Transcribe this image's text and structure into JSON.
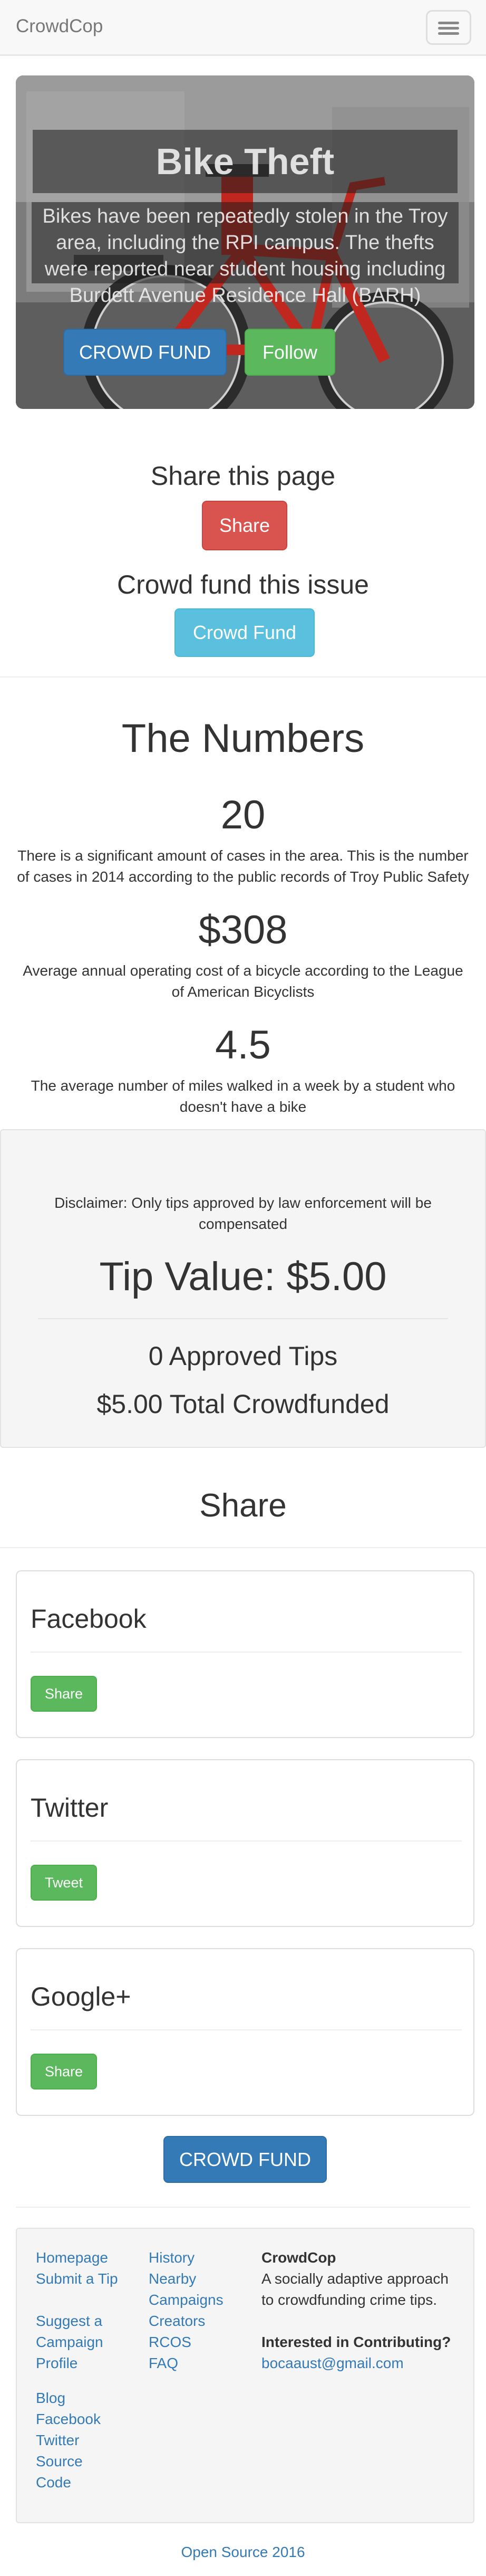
{
  "navbar": {
    "brand": "CrowdCop",
    "toggle_icon": "hamburger-menu-icon"
  },
  "hero": {
    "title": "Bike Theft",
    "description": "Bikes have been repeatedly stolen in the Troy area, including the RPI campus. The thefts were reported near student housing including Burdett Avenue Residence Hall (BARH)",
    "fund_label": "CROWD FUND",
    "follow_label": "Follow",
    "background_image": "red-bicycle-photo"
  },
  "share_section": {
    "heading": "Share this page",
    "share_label": "Share",
    "fund_heading": "Crowd fund this issue",
    "fund_label": "Crowd Fund"
  },
  "numbers": {
    "heading": "The Numbers",
    "stats": [
      {
        "value": "20",
        "description": "There is a significant amount of cases in the area. This is the number of cases in 2014 according to the public records of Troy Public Safety"
      },
      {
        "value": "$308",
        "description": "Average annual operating cost of a bicycle according to the League of American Bicyclists"
      },
      {
        "value": "4.5",
        "description": "The average number of miles walked in a week by a student who doesn't have a bike"
      }
    ]
  },
  "tips": {
    "disclaimer": "Disclaimer: Only tips approved by law enforcement will be compensated",
    "tip_value": "Tip Value: $5.00",
    "approved": "0 Approved Tips",
    "total": "$5.00 Total Crowdfunded"
  },
  "social": {
    "heading": "Share",
    "panels": [
      {
        "title": "Facebook",
        "button": "Share"
      },
      {
        "title": "Twitter",
        "button": "Tweet"
      },
      {
        "title": "Google+",
        "button": "Share"
      }
    ],
    "fund_label": "CROWD FUND"
  },
  "footer": {
    "col1": [
      "Homepage",
      "Submit a Tip",
      "Suggest a Campaign",
      "Profile"
    ],
    "col1b": [
      "Blog",
      "Facebook",
      "Twitter",
      "Source Code"
    ],
    "col2": [
      "History",
      "Nearby Campaigns",
      "Creators",
      "RCOS",
      "FAQ"
    ],
    "about_title": "CrowdCop",
    "about_text": "A socially adaptive approach to crowdfunding crime tips.",
    "contrib_title": "Interested in Contributing?",
    "contrib_email": "bocaaust@gmail.com",
    "bottom_link": "Open Source 2016"
  },
  "colors": {
    "primary": "#337ab7",
    "success": "#5cb85c",
    "danger": "#d9534f",
    "info": "#5bc0de",
    "link": "#337ab7"
  }
}
